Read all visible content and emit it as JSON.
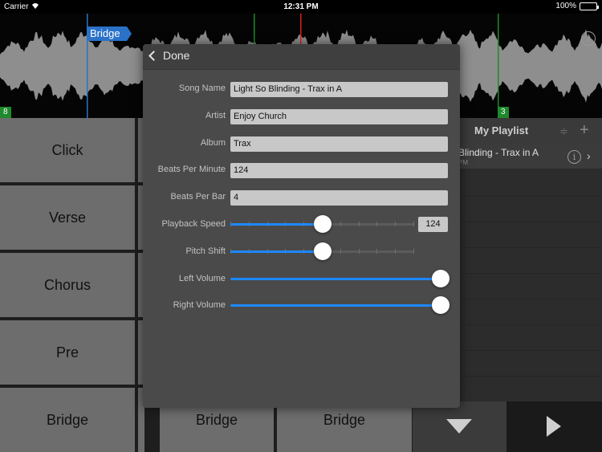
{
  "status_bar": {
    "carrier": "Carrier",
    "time": "12:31 PM",
    "battery": "100%"
  },
  "waveform": {
    "marker_label": "Bridge",
    "bar_numbers": [
      "8",
      "3"
    ],
    "colors": {
      "marker": "#2a72c8",
      "bar_badge": "#1e8a2c",
      "playhead": "#e02020",
      "section_line": "#1e8a2c"
    }
  },
  "pads": {
    "left": [
      "Click",
      "Verse",
      "Chorus",
      "Pre",
      "Bridge"
    ],
    "bottom": [
      "Bridge",
      "Bridge"
    ]
  },
  "playlist": {
    "title": "My Playlist",
    "add_icon": "+",
    "items": [
      {
        "title": "Blinding - Trax in A",
        "subtitle": "PM"
      }
    ]
  },
  "transport": {
    "down_icon": "triangle-down-icon",
    "play_icon": "play-icon"
  },
  "settings": {
    "done_label": "Done",
    "fields": {
      "song_name": {
        "label": "Song Name",
        "value": "Light So Blinding - Trax in A"
      },
      "artist": {
        "label": "Artist",
        "value": "Enjoy Church"
      },
      "album": {
        "label": "Album",
        "value": "Trax"
      },
      "bpm": {
        "label": "Beats Per Minute",
        "value": "124"
      },
      "bpb": {
        "label": "Beats Per Bar",
        "value": "4"
      }
    },
    "sliders": {
      "playback_speed": {
        "label": "Playback Speed",
        "level": 0.5,
        "readout": "124"
      },
      "pitch_shift": {
        "label": "Pitch Shift",
        "level": 0.5
      },
      "left_volume": {
        "label": "Left Volume",
        "level": 1.0
      },
      "right_volume": {
        "label": "Right Volume",
        "level": 1.0
      }
    },
    "accent_color": "#1e88ff"
  }
}
